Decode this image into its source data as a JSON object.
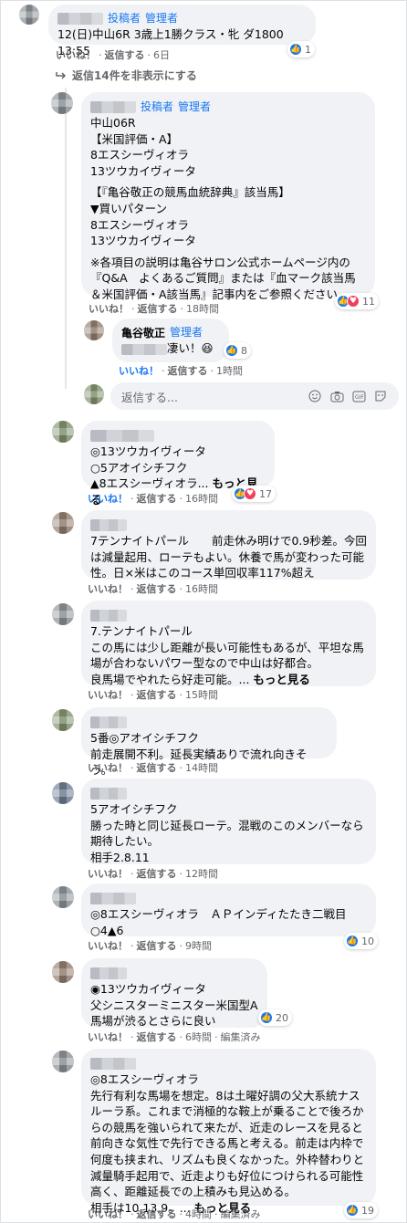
{
  "common": {
    "like": "いいね！",
    "reply": "返信する",
    "poster_tag": "投稿者",
    "admin_tag": "管理者",
    "dot": "·"
  },
  "top_comment": {
    "text": "12(日)中山6R 3歳上1勝クラス・牝 ダ1800 13:55",
    "time": "6日",
    "reaction_count": "1"
  },
  "hidden_replies": "返信14件を非表示にする",
  "reply1": {
    "text_a": "中山06R\n【米国評価・A】\n8エスシーヴィオラ\n13ツウカイヴィータ",
    "text_b": "【『亀谷敬正の競馬血統辞典』該当馬】\n▼買いパターン\n8エスシーヴィオラ\n13ツウカイヴィータ",
    "text_c": "※各項目の説明は亀谷サロン公式ホームページ内の『Q&A　よくあるご質問』または『血マーク該当馬＆米国評価・A該当馬』記事内をご参照ください。",
    "time": "18時間",
    "reaction_count": "11"
  },
  "reply2": {
    "author": "亀谷敬正",
    "text": "凄い！😆",
    "time": "1時間",
    "reaction_count": "8"
  },
  "reply_box": {
    "placeholder": "返信する..."
  },
  "comments": [
    {
      "text": "◎13ツウカイヴィータ\n○5アオイシチフク\n▲8エスシーヴィオラ... ",
      "more": "もっと見る",
      "time": "16時間",
      "reaction_count": "17"
    },
    {
      "text": "7テンナイトパール　　前走休み明けで0.9秒差。今回は減量起用、ローテもよい。休養で馬が変わった可能性。日×米はこのコース単回収率117%超え",
      "time": "16時間"
    },
    {
      "text": "7.テンナイトパール\nこの馬には少し距離が長い可能性もあるが、平坦な馬場が合わないパワー型なので中山は好都合。\n良馬場でやれたら好走可能。... ",
      "more": "もっと見る",
      "time": "15時間"
    },
    {
      "text": "5番◎アオイシチフク\n前走展開不利。延長実績ありで流れ向きそう。",
      "time": "14時間"
    },
    {
      "text": "5アオイシチフク\n勝った時と同じ延長ローテ。混戦のこのメンバーなら期待したい。\n相手2.8.11",
      "time": "12時間"
    },
    {
      "text": "◎8エスシーヴィオラ　ＡＰインディたたき二戦目\n○4▲6",
      "time": "9時間",
      "reaction_count": "10"
    },
    {
      "text": "◉13ツウカイヴィータ\n父シニスターミニスター米国型A\n馬場が渋るとさらに良い",
      "time": "6時間",
      "edited": "編集済み",
      "reaction_count": "20"
    },
    {
      "text": "◎8エスシーヴィオラ\n先行有利な馬場を想定。8は土曜好調の父大系統ナスルーラ系。これまで消極的な鞍上が乗ることで後ろからの競馬を強いられて来たが、近走のレースを見ると前向きな気性で先行できる馬と考える。前走は内枠で何度も挟まれ、リズムも良くなかった。外枠替わりと減量騎手起用で、近走よりも好位につけられる可能性高く、距離延長での上積みも見込める。\n相手は10,13,9。... ",
      "more": "もっと見る",
      "time": "4時間",
      "edited": "編集済み",
      "reaction_count": "19"
    }
  ]
}
